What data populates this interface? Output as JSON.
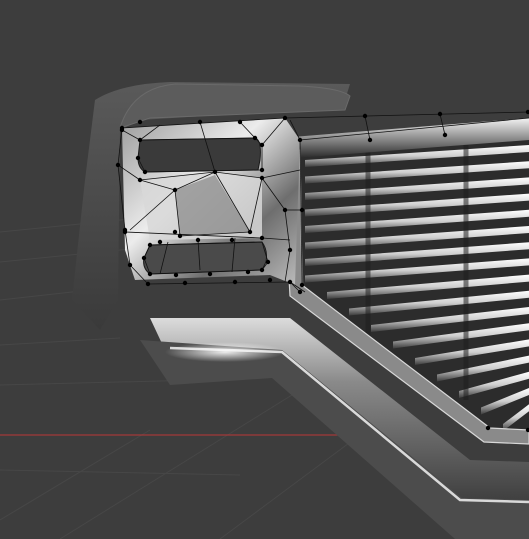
{
  "viewport": {
    "mode": "edit-mode-mesh",
    "background_color": "#3d3d3d",
    "grid_color": "#474747",
    "x_axis_color": "#a23a3a"
  },
  "model": {
    "name": "truck-front-grille",
    "edge_color": "#111111",
    "vertex_color": "#000000",
    "grille_bar_count": 17
  }
}
